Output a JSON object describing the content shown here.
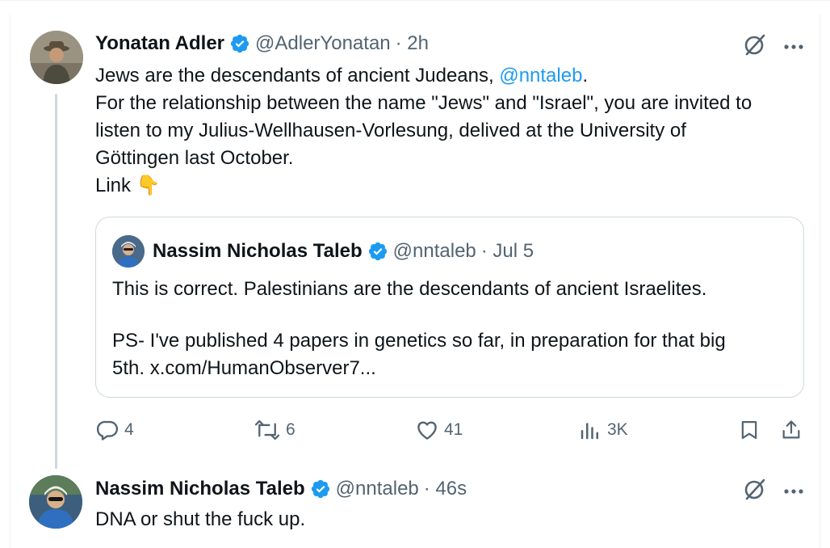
{
  "tweet": {
    "author_name": "Yonatan Adler",
    "handle": "@AdlerYonatan",
    "time": "· 2h",
    "text": {
      "line1_prefix": "Jews are the descendants of ancient Judeans, ",
      "line1_mention": "@nntaleb",
      "line1_suffix": ".",
      "line2": "For the relationship between the name \"Jews\" and \"Israel\", you are invited to",
      "line3": "listen to my Julius-Wellhausen-Vorlesung, delived at the University of",
      "line4": "Göttingen last October.",
      "line5": "Link 👇"
    },
    "quote": {
      "author_name": "Nassim Nicholas Taleb",
      "handle": "@nntaleb",
      "time": "· Jul 5",
      "line1": "This is correct. Palestinians are the descendants of ancient Israelites.",
      "line2": "PS- I've published 4 papers in genetics so far, in preparation for that big",
      "line3": "5th. x.com/HumanObserver7..."
    },
    "actions": {
      "replies": "4",
      "reposts": "6",
      "likes": "41",
      "views": "3K"
    }
  },
  "reply": {
    "author_name": "Nassim Nicholas Taleb",
    "handle": "@nntaleb",
    "time": "· 46s",
    "text": "DNA or shut the fuck up."
  },
  "icons": {
    "verified": "verified-badge-icon",
    "grok": "grok-icon",
    "more": "more-icon",
    "reply": "reply-icon",
    "repost": "repost-icon",
    "like": "like-icon",
    "views": "views-icon",
    "bookmark": "bookmark-icon",
    "share": "share-icon"
  },
  "colors": {
    "accent": "#1d9bf0",
    "text": "#0f1419",
    "muted": "#536471",
    "border": "#cfd9de"
  }
}
